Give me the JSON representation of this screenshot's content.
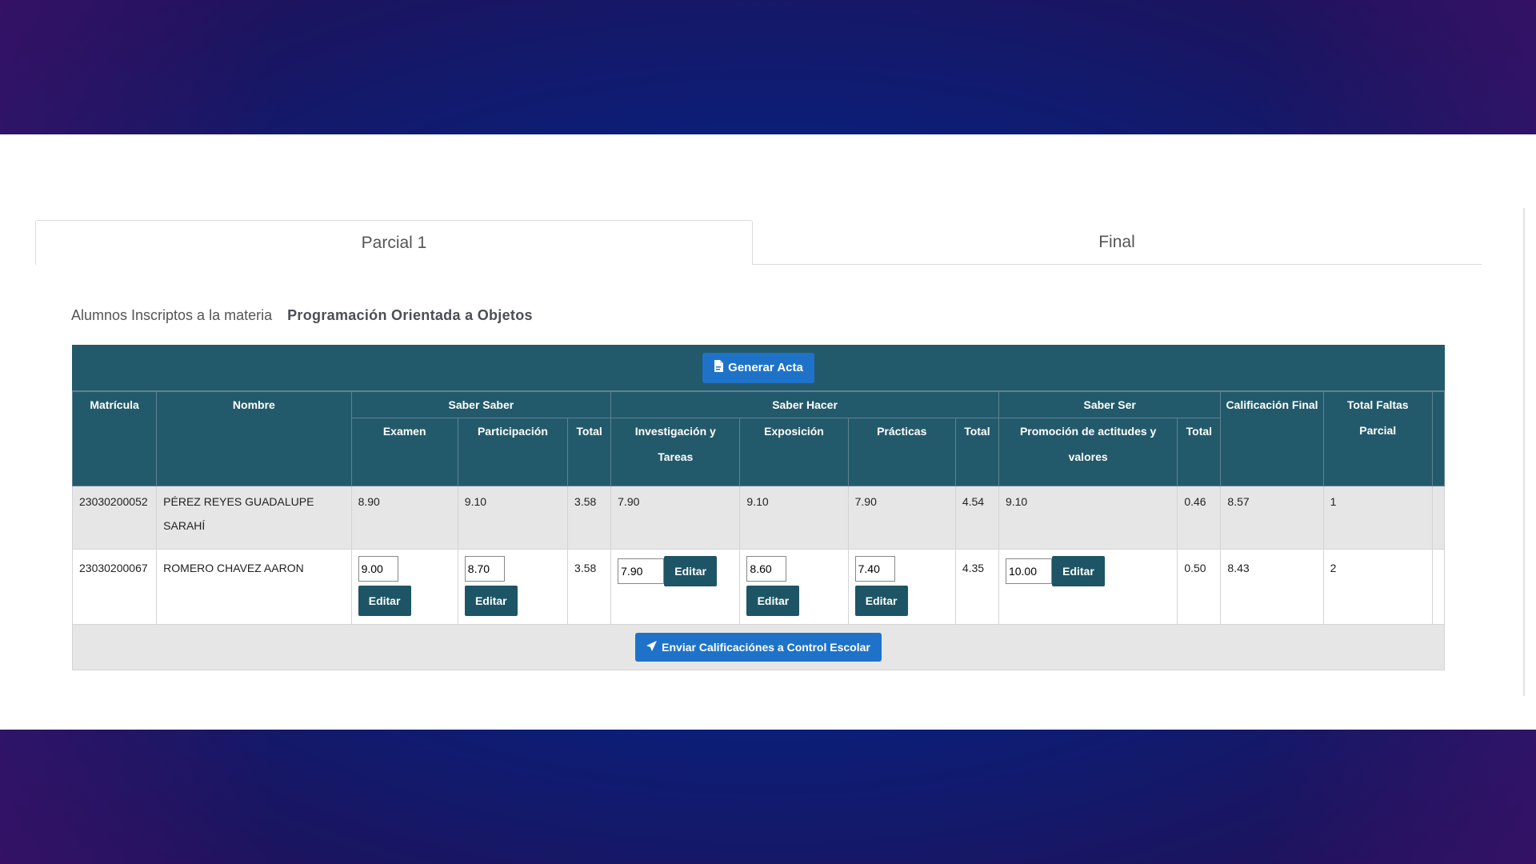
{
  "tabs": [
    {
      "label": "Parcial 1",
      "active": true
    },
    {
      "label": "Final",
      "active": false
    }
  ],
  "subject": {
    "prefix": "Alumnos Inscriptos a la materia",
    "name": "Programación Orientada a Objetos"
  },
  "toolbar": {
    "generate_label": "Generar Acta",
    "generate_icon": "pdf-file-icon"
  },
  "headers": {
    "matricula": "Matrícula",
    "nombre": "Nombre",
    "saber_saber": "Saber Saber",
    "saber_hacer": "Saber Hacer",
    "saber_ser": "Saber Ser",
    "calificacion_final": "Calificación Final",
    "total_faltas": "Total Faltas Parcial",
    "examen": "Examen",
    "participacion": "Participación",
    "total": "Total",
    "investigacion": "Investigación y Tareas",
    "exposicion": "Exposición",
    "practicas": "Prácticas",
    "promocion": "Promoción de actitudes y valores"
  },
  "rows": [
    {
      "matricula": "23030200052",
      "nombre": "PÉREZ REYES GUADALUPE SARAHÍ",
      "examen": "8.90",
      "participacion": "9.10",
      "total_saber": "3.58",
      "investigacion": "7.90",
      "exposicion": "9.10",
      "practicas": "7.90",
      "total_hacer": "4.54",
      "promocion": "9.10",
      "total_ser": "0.46",
      "final": "8.57",
      "faltas": "1"
    },
    {
      "matricula": "23030200067",
      "nombre": "ROMERO CHAVEZ AARON",
      "examen": "9.00",
      "participacion": "8.70",
      "total_saber": "3.58",
      "investigacion": "7.90",
      "exposicion": "8.60",
      "practicas": "7.40",
      "total_hacer": "4.35",
      "promocion": "10.00",
      "total_ser": "0.50",
      "final": "8.43",
      "faltas": "2",
      "edit_label": "Editar"
    }
  ],
  "footer": {
    "send_label": "Enviar Calificaciónes a Control Escolar",
    "send_icon": "send-arrow-icon"
  }
}
